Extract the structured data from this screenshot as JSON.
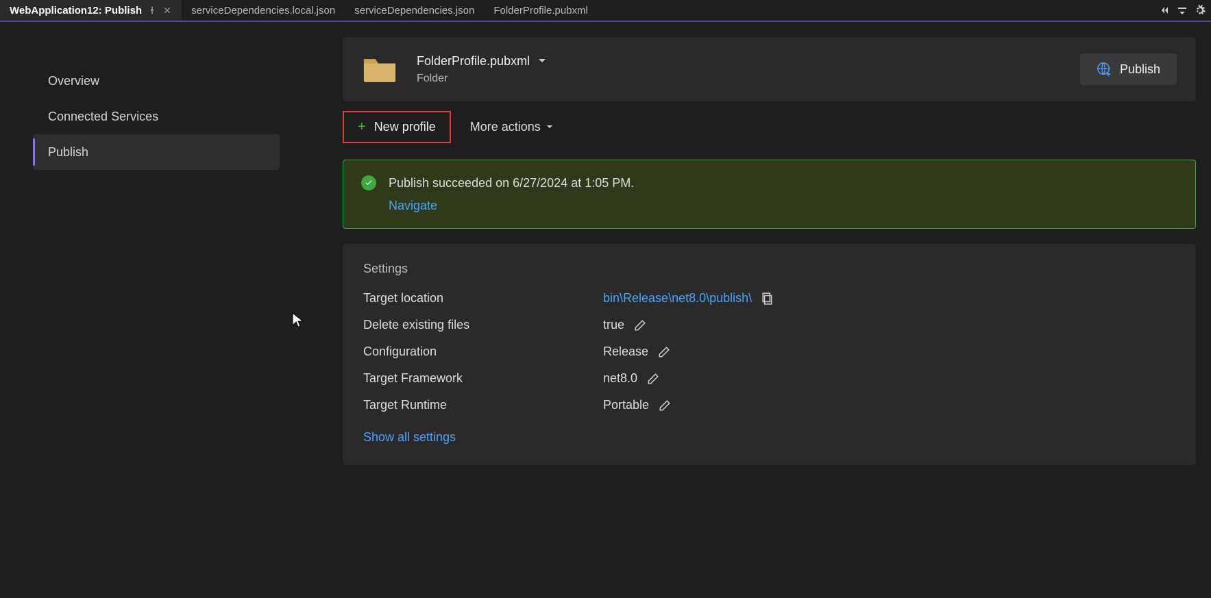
{
  "tabs": {
    "active": "WebApplication12: Publish",
    "others": [
      "serviceDependencies.local.json",
      "serviceDependencies.json",
      "FolderProfile.pubxml"
    ]
  },
  "sidebar": {
    "items": [
      {
        "label": "Overview"
      },
      {
        "label": "Connected Services"
      },
      {
        "label": "Publish"
      }
    ]
  },
  "profile": {
    "name": "FolderProfile.pubxml",
    "type": "Folder",
    "publish_label": "Publish"
  },
  "actions": {
    "new_profile": "New profile",
    "more_actions": "More actions"
  },
  "status": {
    "message": "Publish succeeded on 6/27/2024 at 1:05 PM.",
    "navigate_label": "Navigate"
  },
  "settings": {
    "title": "Settings",
    "rows": [
      {
        "label": "Target location",
        "value": "bin\\Release\\net8.0\\publish\\",
        "link": true,
        "copy": true
      },
      {
        "label": "Delete existing files",
        "value": "true",
        "edit": true
      },
      {
        "label": "Configuration",
        "value": "Release",
        "edit": true
      },
      {
        "label": "Target Framework",
        "value": "net8.0",
        "edit": true
      },
      {
        "label": "Target Runtime",
        "value": "Portable",
        "edit": true
      }
    ],
    "show_all": "Show all settings"
  }
}
